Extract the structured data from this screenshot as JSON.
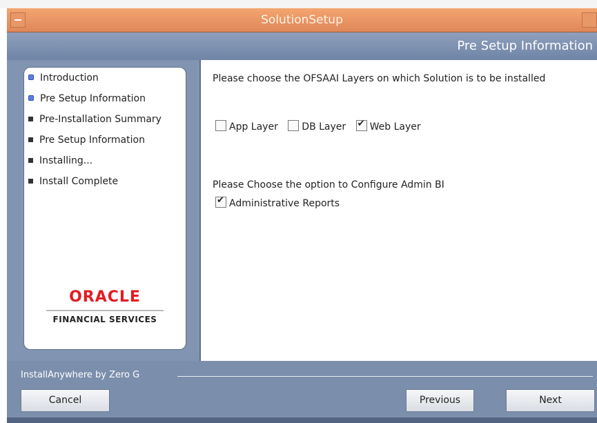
{
  "window": {
    "title": "SolutionSetup"
  },
  "header": {
    "title": "Pre Setup Information"
  },
  "steps": [
    {
      "label": "Introduction",
      "state": "done"
    },
    {
      "label": "Pre Setup Information",
      "state": "done"
    },
    {
      "label": "Pre-Installation Summary",
      "state": "todo"
    },
    {
      "label": "Pre Setup Information",
      "state": "todo"
    },
    {
      "label": "Installing...",
      "state": "todo"
    },
    {
      "label": "Install Complete",
      "state": "todo"
    }
  ],
  "logo": {
    "brand": "ORACLE",
    "sub": "FINANCIAL SERVICES"
  },
  "main": {
    "layers_prompt": "Please choose the OFSAAI Layers on which Solution is to be installed",
    "layers": [
      {
        "label": "App Layer",
        "checked": false
      },
      {
        "label": "DB Layer",
        "checked": false
      },
      {
        "label": "Web Layer",
        "checked": true
      }
    ],
    "admin_prompt": "Please Choose the option to Configure Admin BI",
    "admin_option": {
      "label": "Administrative Reports",
      "checked": true
    }
  },
  "footer": {
    "installer_label": "InstallAnywhere by Zero G",
    "cancel_label": "Cancel",
    "previous_label": "Previous",
    "next_label": "Next"
  },
  "colors": {
    "title_bar": "#e8956a",
    "header_band": "#7f93b1",
    "brand_red": "#e31b23",
    "step_done": "#5c7fe0"
  },
  "icons": {
    "check": "check-icon",
    "bullet_done": "circle-bullet-icon",
    "bullet_todo": "square-bullet-icon"
  }
}
